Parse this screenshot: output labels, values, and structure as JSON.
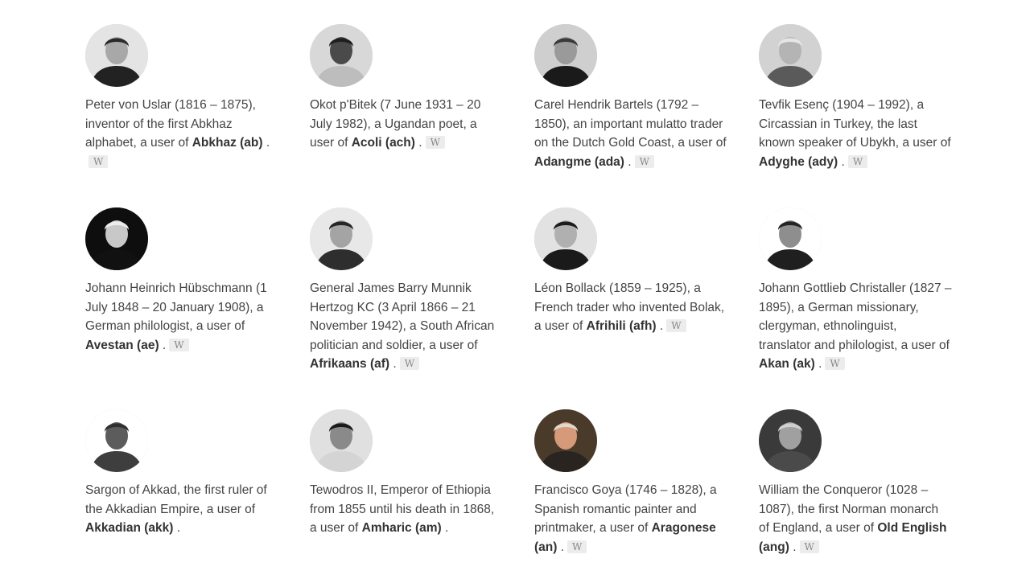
{
  "people": [
    {
      "desc": "Peter von Uslar (1816 – 1875), inventor of the first Abkhaz alphabet, a user of ",
      "lang": "Abkhaz (ab)",
      "end": " .",
      "wiki": "W",
      "bg": "#e4e4e4",
      "face": "#a8a8a8",
      "hair": "#2a2a2a",
      "coat": "#222222"
    },
    {
      "desc": "Okot p'Bitek (7 June 1931 – 20 July 1982), a Ugandan poet, a user of ",
      "lang": "Acoli (ach)",
      "end": " .",
      "wiki": "W",
      "bg": "#d8d8d8",
      "face": "#4a4a4a",
      "hair": "#1e1e1e",
      "coat": "#bdbdbd"
    },
    {
      "desc": "Carel Hendrik Bartels (1792 – 1850), an important mulatto trader on the Dutch Gold Coast, a user of ",
      "lang": "Adangme (ada)",
      "end": " .",
      "wiki": "W",
      "bg": "#cfcfcf",
      "face": "#9a9a9a",
      "hair": "#3a3a3a",
      "coat": "#1a1a1a"
    },
    {
      "desc": "Tevfik Esenç (1904 – 1992), a Circassian in Turkey, the last known speaker of Ubykh, a user of ",
      "lang": "Adyghe (ady)",
      "end": " .",
      "wiki": "W",
      "bg": "#d2d2d2",
      "face": "#b4b4b4",
      "hair": "#e6e6e6",
      "coat": "#5a5a5a"
    },
    {
      "desc": "Johann Heinrich Hübschmann (1 July 1848 – 20 January 1908), a German philologist, a user of ",
      "lang": "Avestan (ae)",
      "end": " .",
      "wiki": "W",
      "bg": "#0e0e0e",
      "face": "#c8c8c8",
      "hair": "#ececec",
      "coat": "#111111"
    },
    {
      "desc": "General James Barry Munnik Hertzog KC (3 April 1866 – 21 November 1942), a South African politician and soldier, a user of ",
      "lang": "Afrikaans (af)",
      "end": " .",
      "wiki": "W",
      "bg": "#e8e8e8",
      "face": "#a4a4a4",
      "hair": "#262626",
      "coat": "#2e2e2e"
    },
    {
      "desc": "Léon Bollack (1859 – 1925), a French trader who invented Bolak, a user of ",
      "lang": "Afrihili (afh)",
      "end": " .",
      "wiki": "W",
      "bg": "#e2e2e2",
      "face": "#b0b0b0",
      "hair": "#1c1c1c",
      "coat": "#1a1a1a"
    },
    {
      "desc": "Johann Gottlieb Christaller (1827 – 1895), a German missionary, clergyman, ethnolinguist, translator and philologist, a user of ",
      "lang": "Akan (ak)",
      "end": " .",
      "wiki": "W",
      "bg": "#ffffff",
      "face": "#8e8e8e",
      "hair": "#242424",
      "coat": "#1f1f1f"
    },
    {
      "desc": "Sargon of Akkad, the first ruler of the Akkadian Empire, a user of ",
      "lang": "Akkadian (akk)",
      "end": " .",
      "wiki": "",
      "bg": "#ffffff",
      "face": "#5c5c5c",
      "hair": "#2f2f2f",
      "coat": "#3e3e3e"
    },
    {
      "desc": "Tewodros II, Emperor of Ethiopia from 1855 until his death in 1868, a user of ",
      "lang": "Amharic (am)",
      "end": " .",
      "wiki": "",
      "bg": "#e0e0e0",
      "face": "#8a8a8a",
      "hair": "#1a1a1a",
      "coat": "#d4d4d4"
    },
    {
      "desc": "Francisco Goya (1746 – 1828), a Spanish romantic painter and printmaker, a user of ",
      "lang": "Aragonese (an)",
      "end": " .",
      "wiki": "W",
      "bg": "#4a3a2a",
      "face": "#d69a7a",
      "hair": "#e0d8cc",
      "coat": "#2a2420"
    },
    {
      "desc": "William the Conqueror (1028 – 1087), the first Norman monarch of England, a user of ",
      "lang": "Old English (ang)",
      "end": " .",
      "wiki": "W",
      "bg": "#3a3a3a",
      "face": "#a0a0a0",
      "hair": "#cfcfcf",
      "coat": "#4a4a4a"
    }
  ]
}
